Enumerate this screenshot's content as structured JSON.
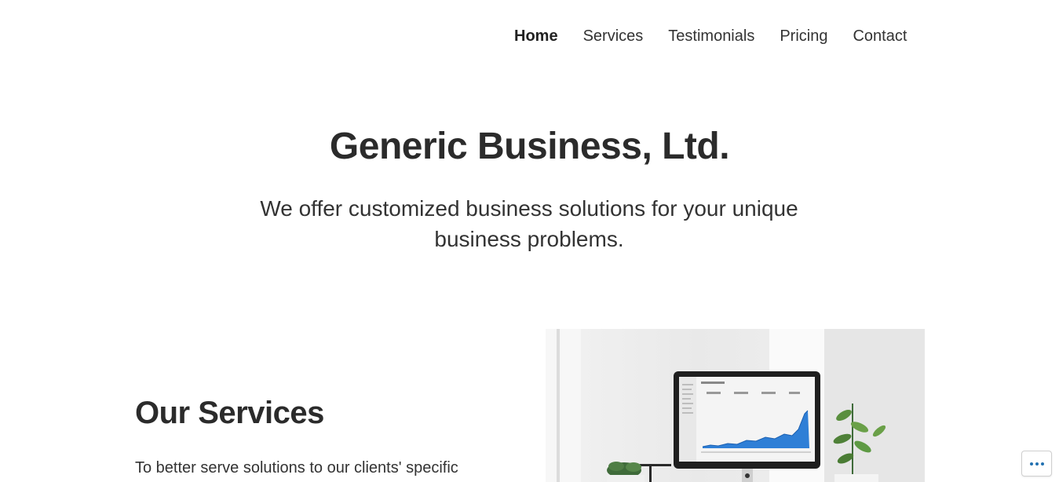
{
  "nav": {
    "items": [
      {
        "label": "Home",
        "active": true
      },
      {
        "label": "Services",
        "active": false
      },
      {
        "label": "Testimonials",
        "active": false
      },
      {
        "label": "Pricing",
        "active": false
      },
      {
        "label": "Contact",
        "active": false
      }
    ]
  },
  "hero": {
    "title": "Generic Business, Ltd.",
    "subtitle": "We offer customized business solutions for your unique business problems."
  },
  "services": {
    "title": "Our Services",
    "text": "To better serve solutions to our clients' specific"
  },
  "image": {
    "icon": "desk-computer-photo"
  },
  "more_button": {
    "icon": "ellipsis-icon",
    "accent": "#2271b1"
  }
}
